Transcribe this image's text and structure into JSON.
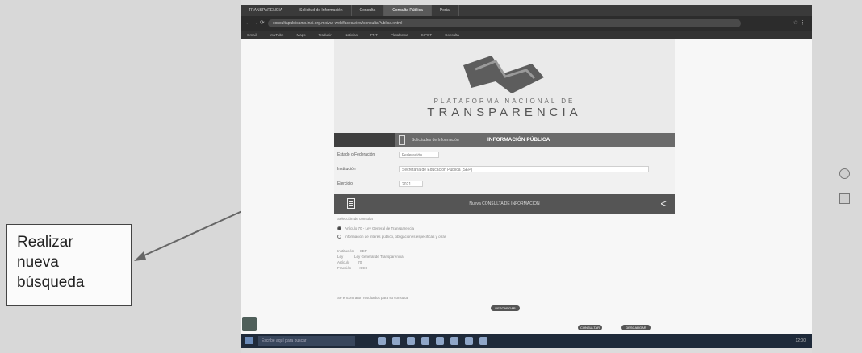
{
  "callout": {
    "line1": "Realizar",
    "line2": "nueva",
    "line3": "búsqueda"
  },
  "browser": {
    "tabs": [
      {
        "label": "TRANSPARENCIA"
      },
      {
        "label": "Solicitud de Información"
      },
      {
        "label": "Consulta"
      },
      {
        "label": "Consulta Pública"
      },
      {
        "label": "Portal"
      }
    ],
    "url": "consultapublicamx.inai.org.mx/vut-web/faces/view/consultaPublica.xhtml",
    "bookmarks": [
      "Gmail",
      "YouTube",
      "Maps",
      "Traducir",
      "Noticias",
      "PNT",
      "Plataforma",
      "SIPOT",
      "Consulta"
    ]
  },
  "site": {
    "title_line1": "PLATAFORMA NACIONAL DE",
    "title_line2": "TRANSPARENCIA",
    "nav": {
      "solicitudes": "Solicitudes de Información",
      "info_publica": "INFORMACIÓN PÚBLICA"
    },
    "form": {
      "rows": [
        {
          "label": "Estado o Federación",
          "value": "Federación"
        },
        {
          "label": "Institución",
          "value": "Secretaría de Educación Pública (SEP)"
        },
        {
          "label": "Ejercicio",
          "value": "2021"
        }
      ]
    },
    "actionbar": {
      "nueva_consulta": "Nueva CONSULTA DE INFORMACIÓN"
    },
    "results": {
      "heading": "Selección de consulta",
      "option1": "Artículo 70 - Ley General de Transparencia",
      "option2": "Información de interés público, obligaciones específicas y otras",
      "fields": [
        {
          "label": "Institución",
          "value": "SEP"
        },
        {
          "label": "Ley",
          "value": "Ley General de Transparencia"
        },
        {
          "label": "Artículo",
          "value": "70"
        },
        {
          "label": "Fracción",
          "value": "XXIII"
        }
      ],
      "footer_text": "Se encontraron resultados para su consulta",
      "btn1": "DESCARGAR",
      "btn2": "CONSULTAR",
      "btn3": "DESCARGAR"
    }
  },
  "taskbar": {
    "search_placeholder": "Escribe aquí para buscar",
    "clock": "12:00"
  }
}
